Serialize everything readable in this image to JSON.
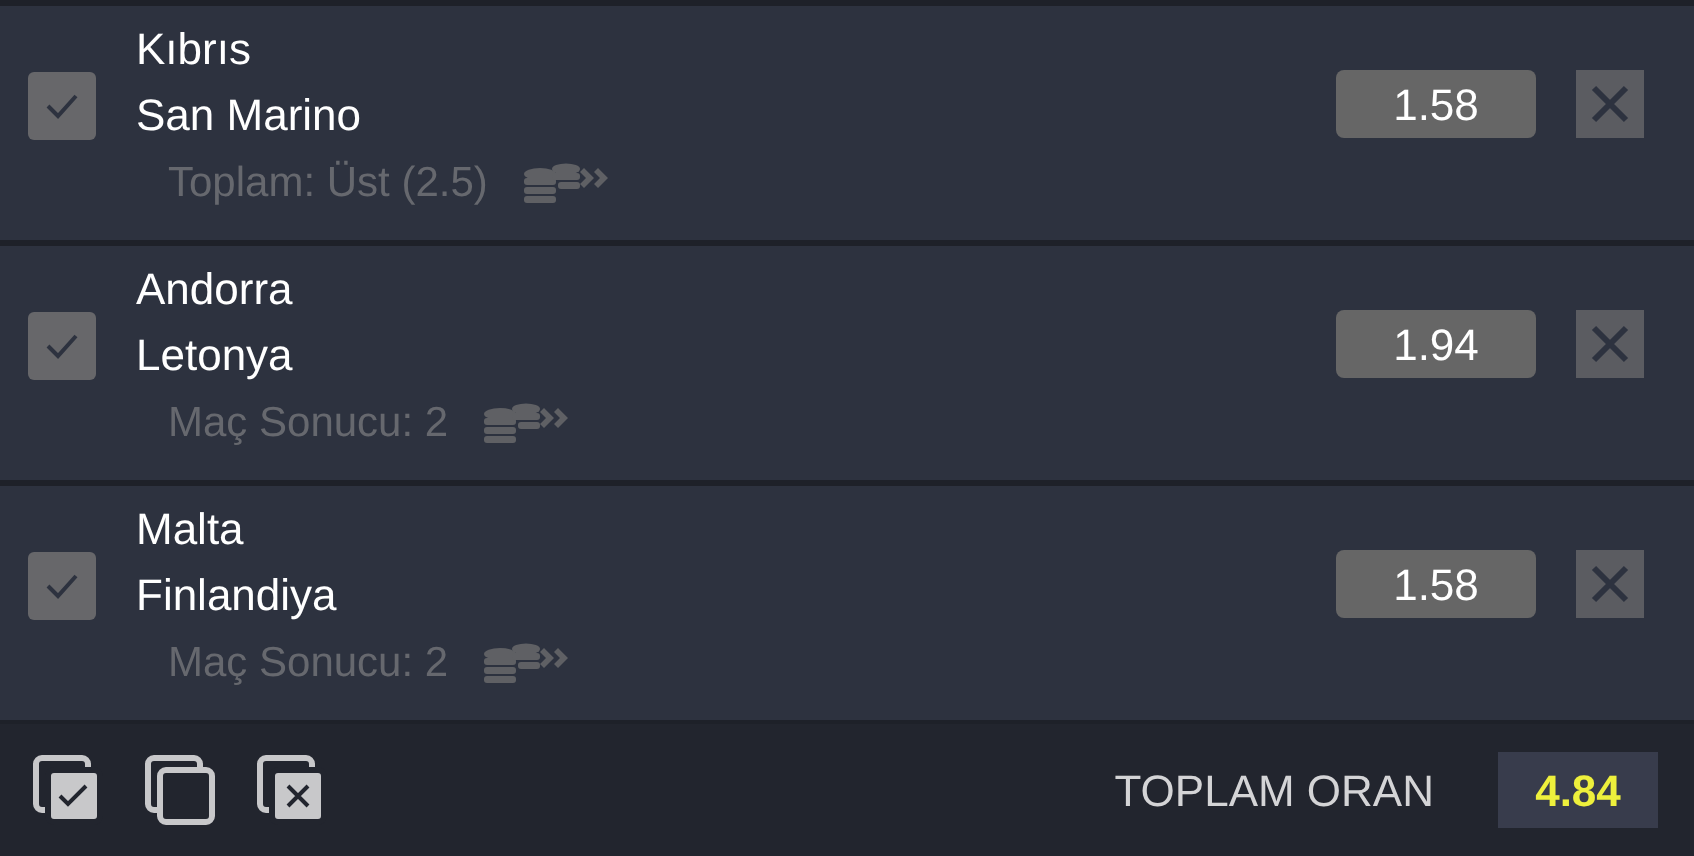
{
  "bets": [
    {
      "checked": true,
      "home": "Kıbrıs",
      "away": "San Marino",
      "market": "Toplam: Üst (2.5)",
      "odds": "1.58"
    },
    {
      "checked": true,
      "home": "Andorra",
      "away": "Letonya",
      "market": "Maç Sonucu: 2",
      "odds": "1.94"
    },
    {
      "checked": true,
      "home": "Malta",
      "away": "Finlandiya",
      "market": "Maç Sonucu: 2",
      "odds": "1.58"
    }
  ],
  "footer": {
    "total_label": "TOPLAM ORAN",
    "total_value": "4.84"
  }
}
